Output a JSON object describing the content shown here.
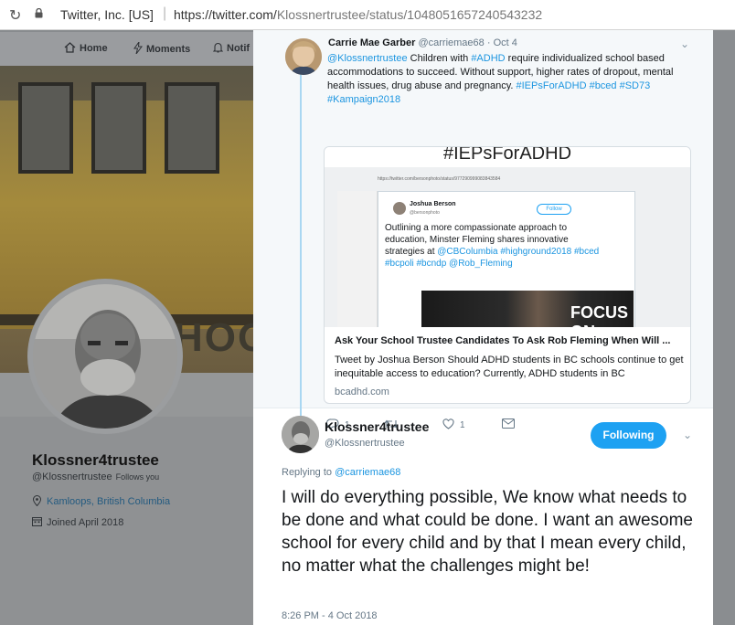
{
  "browser": {
    "org": "Twitter, Inc. [US]",
    "url_host": "https://twitter.com/",
    "url_path": "Klossnertrustee/status/1048051657240543232"
  },
  "nav": {
    "home": "Home",
    "moments": "Moments",
    "notifications": "Notif"
  },
  "banner": {
    "text": "HOOI"
  },
  "profile": {
    "name": "Klossner4trustee",
    "handle": "@Klossnertrustee",
    "follows_you": "Follows you",
    "location": "Kamloops, British Columbia",
    "joined": "Joined April 2018"
  },
  "parent_tweet": {
    "author_name": "Carrie Mae Garber",
    "author_handle": "@carriemae68",
    "date": "Oct 4",
    "mention": "@Klossnertrustee",
    "text_a": "Children with",
    "hashtag_adhd": "#ADHD",
    "text_b": "require individualized school based accommodations to succeed. Without support, higher rates of dropout, mental health issues, drug abuse and pregnancy.",
    "hashtags": "#IEPsForADHD #bced #SD73 #Kampaign2018",
    "card": {
      "image_header": "#IEPsForADHD",
      "image_url": "https://twitter.com/bersonphoto/status/977290999083843584",
      "inner_name": "Joshua Berson",
      "inner_handle": "@bersonphoto",
      "inner_follow": "Follow",
      "inner_text_a": "Outlining a more compassionate approach to education, Minster Fleming shares innovative strategies at",
      "inner_link": "@CBColumbia",
      "inner_tags": "#highground2018 #bced #bcpoli #bcndp @Rob_Fleming",
      "inner_image_text": "FOCUS ON",
      "title": "Ask Your School Trustee Candidates To Ask Rob Fleming When Will ...",
      "description": "Tweet by Joshua Berson Should ADHD students in BC schools continue to get inequitable access to education?   Currently, ADHD students in BC",
      "domain": "bcadhd.com"
    },
    "replies": "1",
    "likes": "1"
  },
  "main_tweet": {
    "author_name": "Klossner4trustee",
    "author_handle": "@Klossnertrustee",
    "follow_button": "Following",
    "replying_label": "Replying to",
    "replying_to": "@carriemae68",
    "text": "I will do everything possible,  We know what needs to be done and what could be done. I want an awesome school for every child and by that I mean every child, no matter what the challenges might be!",
    "timestamp": "8:26 PM - 4 Oct 2018"
  },
  "icons": {
    "reload": "reload-icon",
    "lock": "lock-icon",
    "home": "home-icon",
    "moments": "lightning-icon",
    "notifications": "bell-icon",
    "location": "location-pin-icon",
    "calendar": "calendar-icon",
    "reply": "reply-icon",
    "retweet": "retweet-icon",
    "like": "heart-icon",
    "message": "envelope-icon",
    "chevron": "chevron-down-icon"
  },
  "colors": {
    "twitter_blue": "#1da1f2",
    "link": "#1b95e0",
    "text": "#14171a",
    "secondary": "#657786"
  }
}
